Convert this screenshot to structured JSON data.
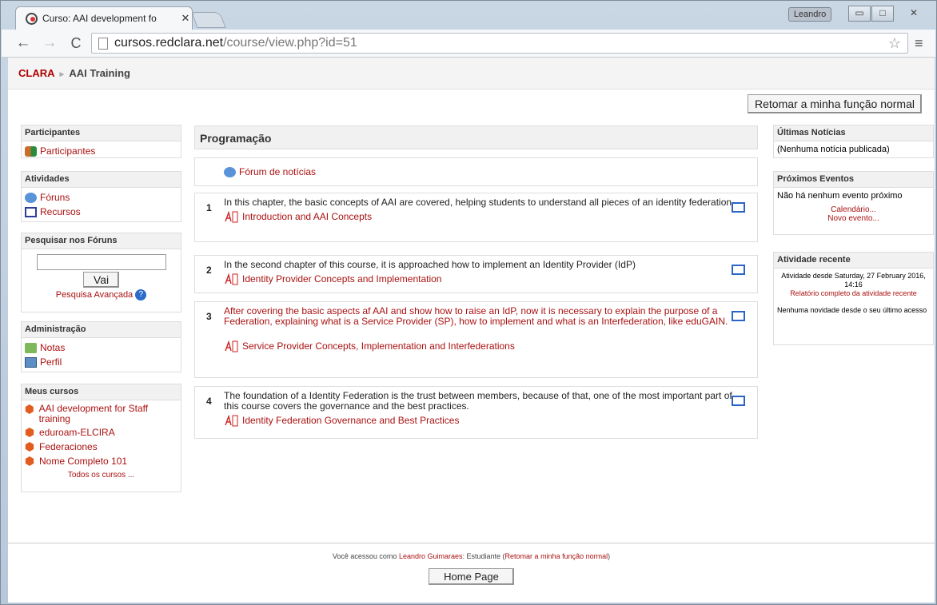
{
  "browser": {
    "tab_title": "Curso: AAI development fo",
    "tab_close": "✕",
    "user_chip": "Leandro",
    "url_host": "cursos.redclara.net",
    "url_path": "/course/view.php?id=51"
  },
  "navbar": {
    "crumb_root": "CLARA",
    "crumb_sep": "►",
    "crumb_current": "AAI Training",
    "return_button": "Retomar a minha função normal"
  },
  "left": {
    "participantes": {
      "title": "Participantes",
      "items": [
        "Participantes"
      ]
    },
    "atividades": {
      "title": "Atividades",
      "items": [
        "Fóruns",
        "Recursos"
      ]
    },
    "pesquisar": {
      "title": "Pesquisar nos Fóruns",
      "button": "Vai",
      "advanced": "Pesquisa Avançada"
    },
    "administracao": {
      "title": "Administração",
      "items": [
        "Notas",
        "Perfil"
      ]
    },
    "meus_cursos": {
      "title": "Meus cursos",
      "items": [
        "AAI development for Staff training",
        "eduroam-ELCIRA",
        "Federaciones",
        "Nome Completo 101"
      ],
      "all": "Todos os cursos ..."
    }
  },
  "center": {
    "title": "Programação",
    "forum": "Fórum de notícias",
    "sections": [
      {
        "num": "1",
        "text": "In this chapter, the basic concepts of AAI are covered, helping students to understand all pieces of an identity federation.",
        "resource": "Introduction and AAI Concepts"
      },
      {
        "num": "2",
        "text": "In the second chapter of this course, it is approached how to implement an Identity Provider (IdP)",
        "resource": "Identity Provider Concepts and Implementation"
      },
      {
        "num": "3",
        "text": "After covering the basic aspects af AAI and show how to raise an IdP, now it is necessary to explain the purpose of a Federation, explaining what is a Service Provider (SP), how to implement and what is an Interfederation, like eduGAIN.",
        "resource": "Service Provider Concepts, Implementation and Interfederations"
      },
      {
        "num": "4",
        "text": "The foundation of a Identity Federation is the trust between members, because of that, one of the most important part of this course covers the governance and the best practices.",
        "resource": "Identity Federation Governance and Best Practices"
      }
    ]
  },
  "right": {
    "noticias": {
      "title": "Últimas Notícias",
      "text": "(Nenhuma notícia publicada)"
    },
    "eventos": {
      "title": "Próximos Eventos",
      "text": "Não há nenhum evento próximo",
      "calendar": "Calendário...",
      "new": "Novo evento..."
    },
    "atividade": {
      "title": "Atividade recente",
      "since": "Atividade desde Saturday, 27 February 2016, 14:16",
      "report": "Relatório completo da atividade recente",
      "none": "Nenhuma novidade desde o seu último acesso"
    }
  },
  "footer": {
    "prefix": "Você acessou como",
    "user": "Leandro Guimaraes",
    "role": ": Estudiante (",
    "return": "Retomar a minha função normal",
    "suffix": ")",
    "home": "Home Page"
  },
  "colors": {
    "link": "#aa1111",
    "edit": "#2a64c6"
  }
}
